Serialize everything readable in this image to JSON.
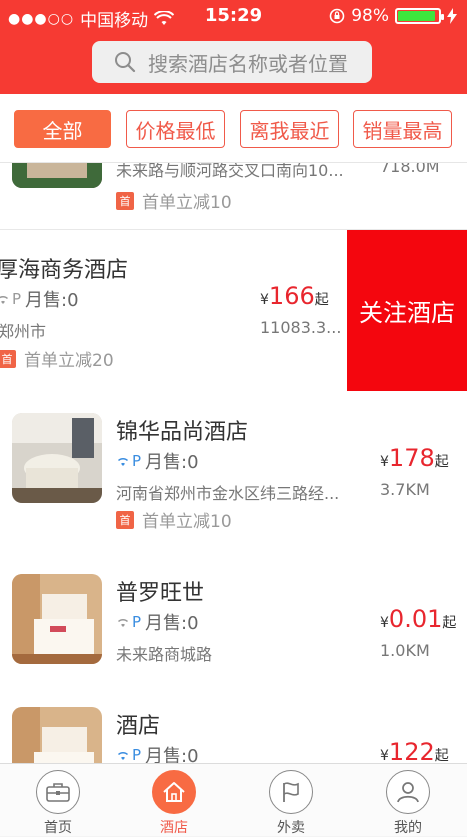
{
  "status": {
    "carrier": "中国移动",
    "time": "15:29",
    "battery": "98%",
    "signal_dots": "●●●○○"
  },
  "search": {
    "placeholder": "搜索酒店名称或者位置"
  },
  "filters": [
    {
      "label": "全部",
      "active": true
    },
    {
      "label": "价格最低",
      "active": false
    },
    {
      "label": "离我最近",
      "active": false
    },
    {
      "label": "销量最高",
      "active": false
    }
  ],
  "hotels": [
    {
      "name": "",
      "sales": "",
      "address": "未来路与顺河路交叉口南向10...",
      "promo": "首单立减10",
      "price": "",
      "distance": "718.0M"
    },
    {
      "name": "厚海商务酒店",
      "sales": "月售:0",
      "address": "郑州市",
      "promo": "首单立减20",
      "price": "166",
      "distance": "11083.3..."
    },
    {
      "name": "锦华品尚酒店",
      "sales": "月售:0",
      "address": "河南省郑州市金水区纬三路经...",
      "promo": "首单立减10",
      "price": "178",
      "distance": "3.7KM"
    },
    {
      "name": "普罗旺世",
      "sales": "月售:0",
      "address": "未来路商城路",
      "promo": "",
      "price": "0.01",
      "distance": "1.0KM"
    },
    {
      "name": "酒店",
      "sales": "月售:0",
      "address": "",
      "promo": "",
      "price": "122",
      "distance": ""
    }
  ],
  "price_suffix": "起",
  "currency": "¥",
  "promo_tag": "首",
  "swipe_action": "关注酒店",
  "tabs": [
    {
      "label": "首页",
      "icon": "briefcase-icon",
      "active": false
    },
    {
      "label": "酒店",
      "icon": "home-icon",
      "active": true
    },
    {
      "label": "外卖",
      "icon": "flag-icon",
      "active": false
    },
    {
      "label": "我的",
      "icon": "user-icon",
      "active": false
    }
  ],
  "colors": {
    "brand_red": "#f63a33",
    "accent_orange": "#f86b43",
    "price_red": "#e8262e",
    "action_red": "#f4060e"
  }
}
